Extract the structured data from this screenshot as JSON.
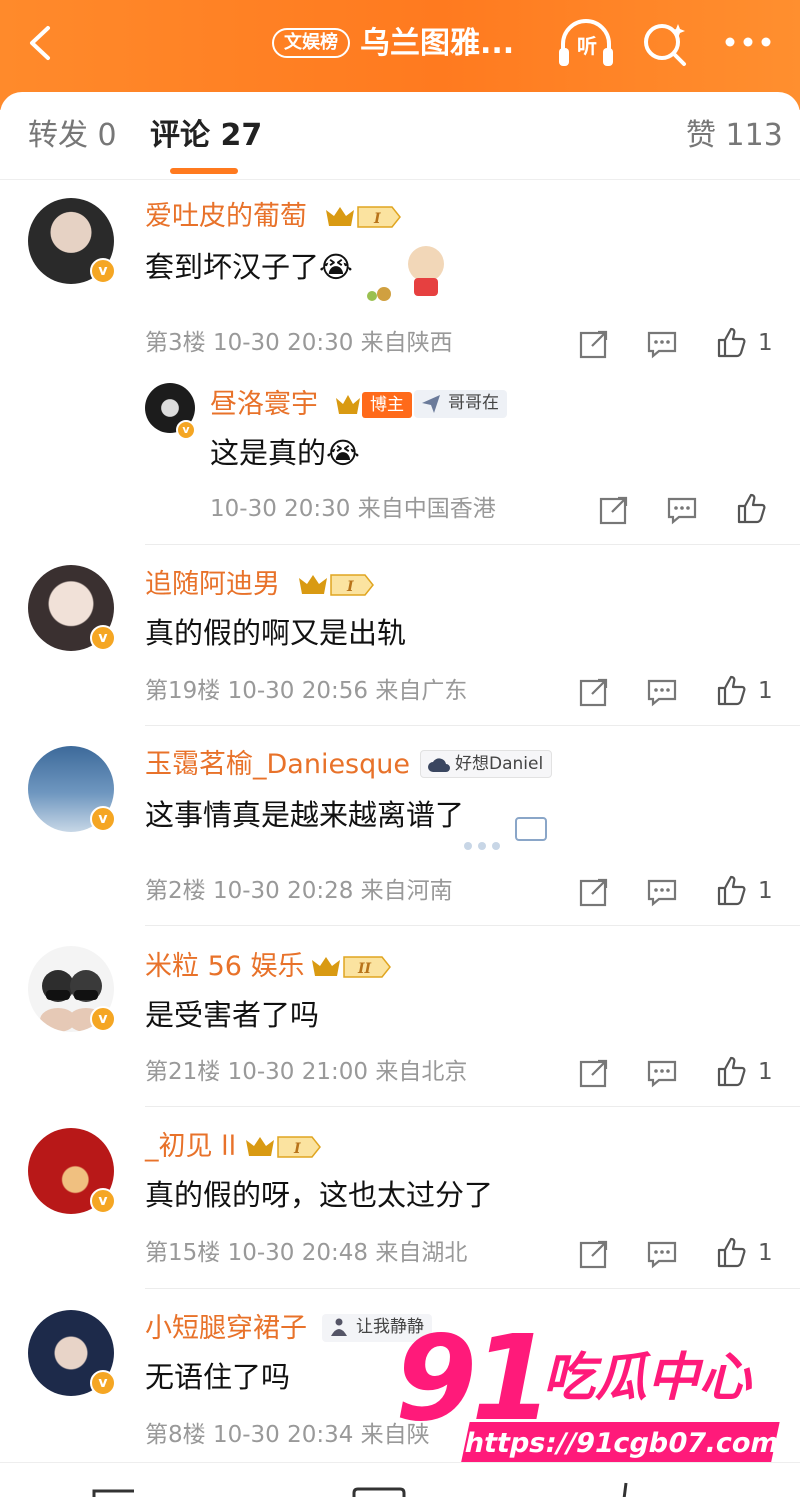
{
  "header": {
    "tag": "文娱榜",
    "title": "乌兰图雅...",
    "listen_label": "听"
  },
  "tabs": {
    "repost": "转发 0",
    "comments": "评论 27",
    "likes": "赞 113"
  },
  "comments": [
    {
      "user": "爱吐皮的葡萄",
      "level": "I",
      "text": "套到坏汉子了😭",
      "meta": "第3楼 10-30 20:30 来自陕西",
      "likes": "1"
    },
    {
      "user": "昼洛寰宇",
      "badge": "博主",
      "tag": "哥哥在",
      "text": "这是真的😭",
      "meta": "10-30 20:30 来自中国香港",
      "likes": ""
    },
    {
      "user": "追随阿迪男",
      "level": "I",
      "text": "真的假的啊又是出轨",
      "meta": "第19楼 10-30 20:56 来自广东",
      "likes": "1"
    },
    {
      "user": "玉霭茗榆_Daniesque",
      "tag": "好想Daniel",
      "text": "这事情真是越来越离谱了",
      "meta": "第2楼 10-30 20:28 来自河南",
      "likes": "1"
    },
    {
      "user": "米粒 56 娱乐",
      "level": "II",
      "text": "是受害者了吗",
      "meta": "第21楼 10-30 21:00 来自北京",
      "likes": "1"
    },
    {
      "user": "_初见 ll",
      "level": "I",
      "text": "真的假的呀，这也太过分了",
      "meta": "第15楼 10-30 20:48 来自湖北",
      "likes": "1"
    },
    {
      "user": "小短腿穿裙子",
      "tag": "让我静静",
      "text": "无语住了吗",
      "meta": "第8楼 10-30 20:34 来自陕",
      "likes": ""
    }
  ],
  "watermark": {
    "number": "91",
    "name": "吃瓜中心",
    "url": "https://91cgb07.com"
  },
  "colors": {
    "brand_orange": "#ff7a1f",
    "username": "#e8722a",
    "watermark_pink": "#ff1a7a"
  }
}
